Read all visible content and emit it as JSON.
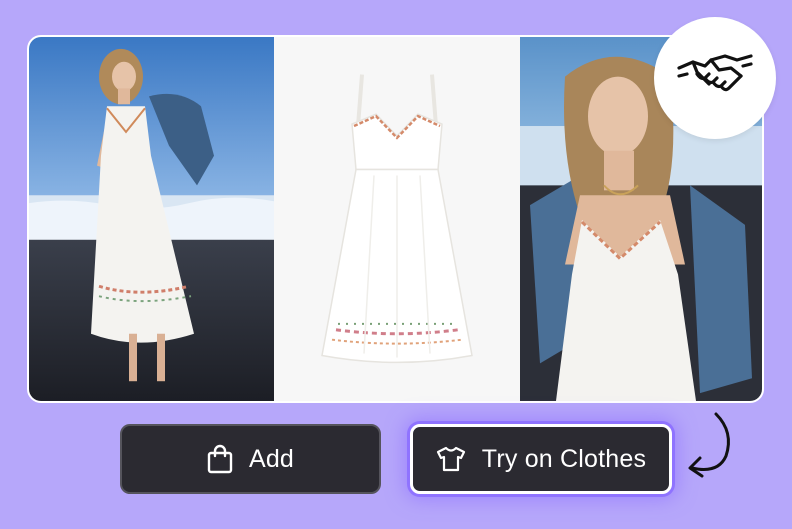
{
  "buttons": {
    "add_label": "Add",
    "try_on_label": "Try on Clothes"
  },
  "icons": {
    "add": "shopping-bag-icon",
    "try_on": "t-shirt-icon",
    "badge": "handshake-icon",
    "arrow": "curved-arrow-icon"
  },
  "colors": {
    "background": "#b6a7fa",
    "button": "#2b2a31",
    "button_glow": "#8f73ff"
  }
}
